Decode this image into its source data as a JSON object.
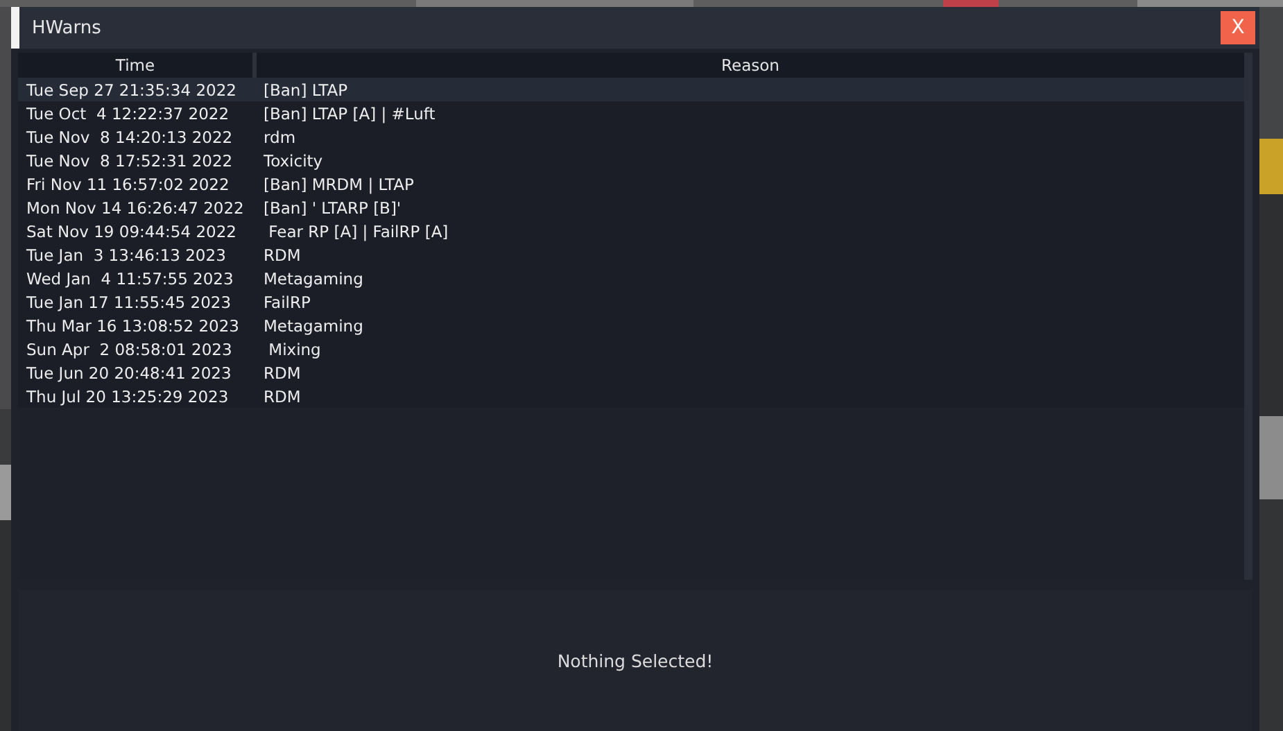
{
  "window": {
    "title": "HWarns",
    "close": "X"
  },
  "table": {
    "columns": [
      "Time",
      "Reason"
    ],
    "rows": [
      {
        "time": "Tue Sep 27 21:35:34 2022",
        "reason": "[Ban] LTAP",
        "selected": true
      },
      {
        "time": "Tue Oct  4 12:22:37 2022",
        "reason": "[Ban] LTAP [A] | #Luft",
        "selected": false
      },
      {
        "time": "Tue Nov  8 14:20:13 2022",
        "reason": "rdm",
        "selected": false
      },
      {
        "time": "Tue Nov  8 17:52:31 2022",
        "reason": "Toxicity",
        "selected": false
      },
      {
        "time": "Fri Nov 11 16:57:02 2022",
        "reason": "[Ban] MRDM | LTAP",
        "selected": false
      },
      {
        "time": "Mon Nov 14 16:26:47 2022",
        "reason": "[Ban] ' LTARP [B]'",
        "selected": false
      },
      {
        "time": "Sat Nov 19 09:44:54 2022",
        "reason": " Fear RP [A] | FailRP [A]",
        "selected": false
      },
      {
        "time": "Tue Jan  3 13:46:13 2023",
        "reason": "RDM",
        "selected": false
      },
      {
        "time": "Wed Jan  4 11:57:55 2023",
        "reason": "Metagaming",
        "selected": false
      },
      {
        "time": "Tue Jan 17 11:55:45 2023",
        "reason": "FailRP",
        "selected": false
      },
      {
        "time": "Thu Mar 16 13:08:52 2023",
        "reason": "Metagaming",
        "selected": false
      },
      {
        "time": "Sun Apr  2 08:58:01 2023",
        "reason": " Mixing",
        "selected": false
      },
      {
        "time": "Tue Jun 20 20:48:41 2023",
        "reason": "RDM",
        "selected": false
      },
      {
        "time": "Thu Jul 20 13:25:29 2023",
        "reason": "RDM",
        "selected": false
      }
    ]
  },
  "details": {
    "message": "Nothing Selected!"
  }
}
